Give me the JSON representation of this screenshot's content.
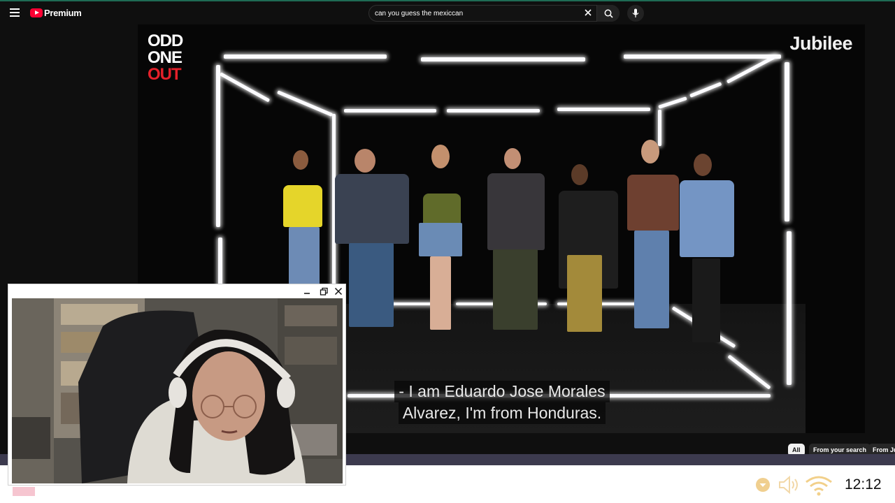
{
  "header": {
    "menu_icon": "hamburger-menu-icon",
    "logo_text": "Premium",
    "search_value": "can you guess the mexiccan",
    "clear_icon": "close-icon",
    "search_icon": "search-icon",
    "mic_icon": "microphone-icon"
  },
  "video": {
    "show_logo_lines": [
      "ODD",
      "ONE",
      "OUT"
    ],
    "brand": "Jubilee",
    "caption_lines": [
      "- I am Eduardo Jose Morales",
      "Alvarez, I'm from Honduras."
    ]
  },
  "chips": [
    "All",
    "From your search",
    "From Jubi"
  ],
  "webcam": {
    "minimize_icon": "minimize-icon",
    "restore_icon": "restore-window-icon",
    "close_icon": "close-icon"
  },
  "taskbar": {
    "time": "12:12",
    "icons": [
      "update-badge-icon",
      "volume-icon",
      "wifi-icon"
    ]
  }
}
